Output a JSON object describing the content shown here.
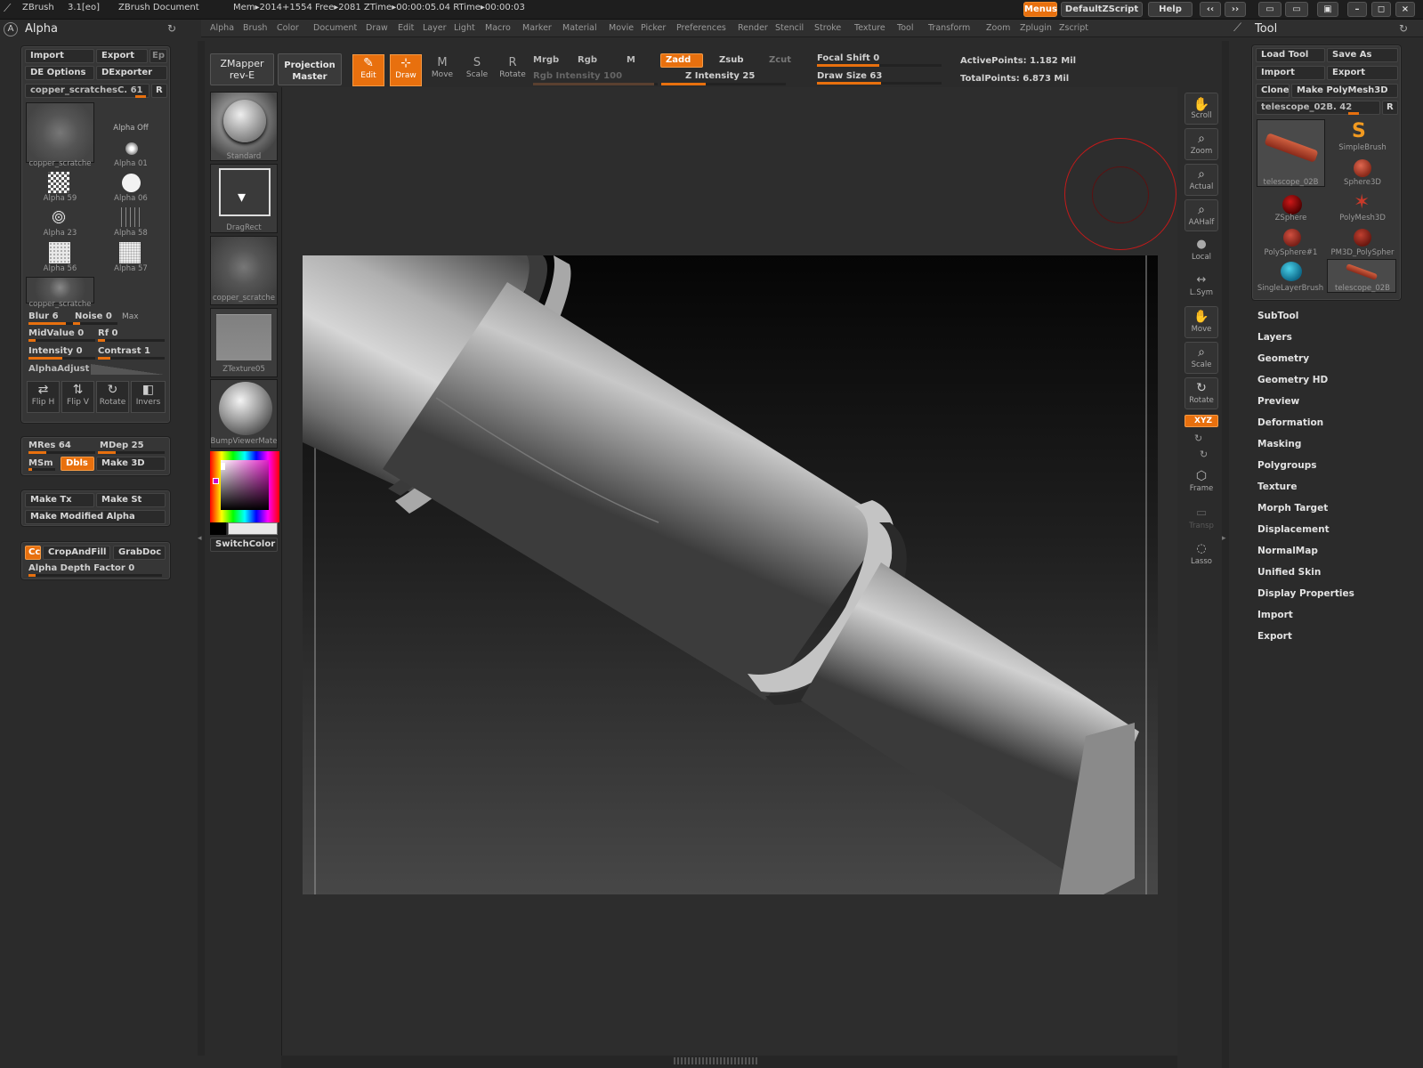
{
  "titlebar": {
    "app": "ZBrush",
    "version": "3.1[eo]",
    "doc": "ZBrush Document",
    "mem": "Mem▸2014+1554 Free▸2081 ZTime▸00:00:05.04 RTime▸00:00:03",
    "menus_btn": "Menus",
    "script_btn": "DefaultZScript",
    "help_btn": "Help"
  },
  "menubar": [
    "Alpha",
    "Brush",
    "Color",
    "Document",
    "Draw",
    "Edit",
    "Layer",
    "Light",
    "Macro",
    "Marker",
    "Material",
    "Movie",
    "Picker",
    "Preferences",
    "Render",
    "Stencil",
    "Stroke",
    "Texture",
    "Tool",
    "Transform",
    "Zoom",
    "Zplugin",
    "Zscript"
  ],
  "alpha_panel": {
    "title": "Alpha",
    "import": "Import",
    "export": "Export",
    "ep": "Ep",
    "de_options": "DE Options",
    "dexporter": "DExporter",
    "current": "copper_scratchesC. 61",
    "r": "R",
    "alpha_off": "Alpha  Off",
    "big_caption": "copper_scratche",
    "items": [
      "Alpha  01",
      "Alpha  59",
      "Alpha  06",
      "Alpha  23",
      "Alpha  58",
      "Alpha  56",
      "Alpha  57"
    ],
    "bottom_caption": "copper_scratche",
    "blur": "Blur 6",
    "noise": "Noise 0",
    "max": "Max",
    "midvalue": "MidValue 0",
    "rf": "Rf 0",
    "intensity": "Intensity 0",
    "contrast": "Contrast 1",
    "alphaadjust": "AlphaAdjust",
    "flip_h": "Flip H",
    "flip_v": "Flip V",
    "rotate": "Rotate",
    "invers": "Invers"
  },
  "alpha_panel2": {
    "mres": "MRes 64",
    "mdep": "MDep 25",
    "msm": "MSm",
    "dbls": "Dbls",
    "make3d": "Make 3D",
    "make_tx": "Make Tx",
    "make_st": "Make St",
    "make_mod": "Make Modified Alpha",
    "cc": "Cc",
    "cropfill": "CropAndFill",
    "grabdoc": "GrabDoc",
    "depth": "Alpha Depth Factor 0"
  },
  "shelf": {
    "standard": "Standard",
    "dragrect": "DragRect",
    "copper": "copper_scratche",
    "ztex": "ZTexture05",
    "bump": "BumpViewerMate",
    "switchcolor": "SwitchColor"
  },
  "toolbar": {
    "zmapper": "ZMapper",
    "zmapper2": "rev-E",
    "proj": "Projection",
    "proj2": "Master",
    "edit": "Edit",
    "draw": "Draw",
    "move": "Move",
    "scale": "Scale",
    "rotate": "Rotate",
    "mrgb": "Mrgb",
    "rgb": "Rgb",
    "m": "M",
    "rgb_int": "Rgb  Intensity 100",
    "zadd": "Zadd",
    "zsub": "Zsub",
    "zcut": "Zcut",
    "z_int": "Z  Intensity 25",
    "focal": "Focal  Shift 0",
    "drawsize": "Draw  Size 63",
    "active": "ActivePoints: 1.182  Mil",
    "total": "TotalPoints: 6.873  Mil"
  },
  "right_tools": [
    "Scroll",
    "Zoom",
    "Actual",
    "AAHalf",
    "Local",
    "L.Sym",
    "Move",
    "Scale",
    "Rotate",
    "Frame",
    "Transp",
    "Lasso"
  ],
  "right_tools_xyz": "XYZ",
  "tool_panel": {
    "title": "Tool",
    "load": "Load  Tool",
    "saveas": "Save  As",
    "import": "Import",
    "export": "Export",
    "clone": "Clone",
    "makepm": "Make  PolyMesh3D",
    "current": "telescope_02B. 42",
    "r": "R",
    "items": [
      "telescope_02B",
      "SimpleBrush",
      "Sphere3D",
      "ZSphere",
      "PolyMesh3D",
      "PolySphere#1",
      "PM3D_PolySpher",
      "SingleLayerBrush",
      "telescope_02B"
    ]
  },
  "tool_sections": [
    "SubTool",
    "Layers",
    "Geometry",
    "Geometry  HD",
    "Preview",
    "Deformation",
    "Masking",
    "Polygroups",
    "Texture",
    "Morph  Target",
    "Displacement",
    "NormalMap",
    "Unified  Skin",
    "Display  Properties",
    "Import",
    "Export"
  ],
  "colors": {
    "accent": "#e8700e",
    "bg": "#2b2b2b"
  }
}
